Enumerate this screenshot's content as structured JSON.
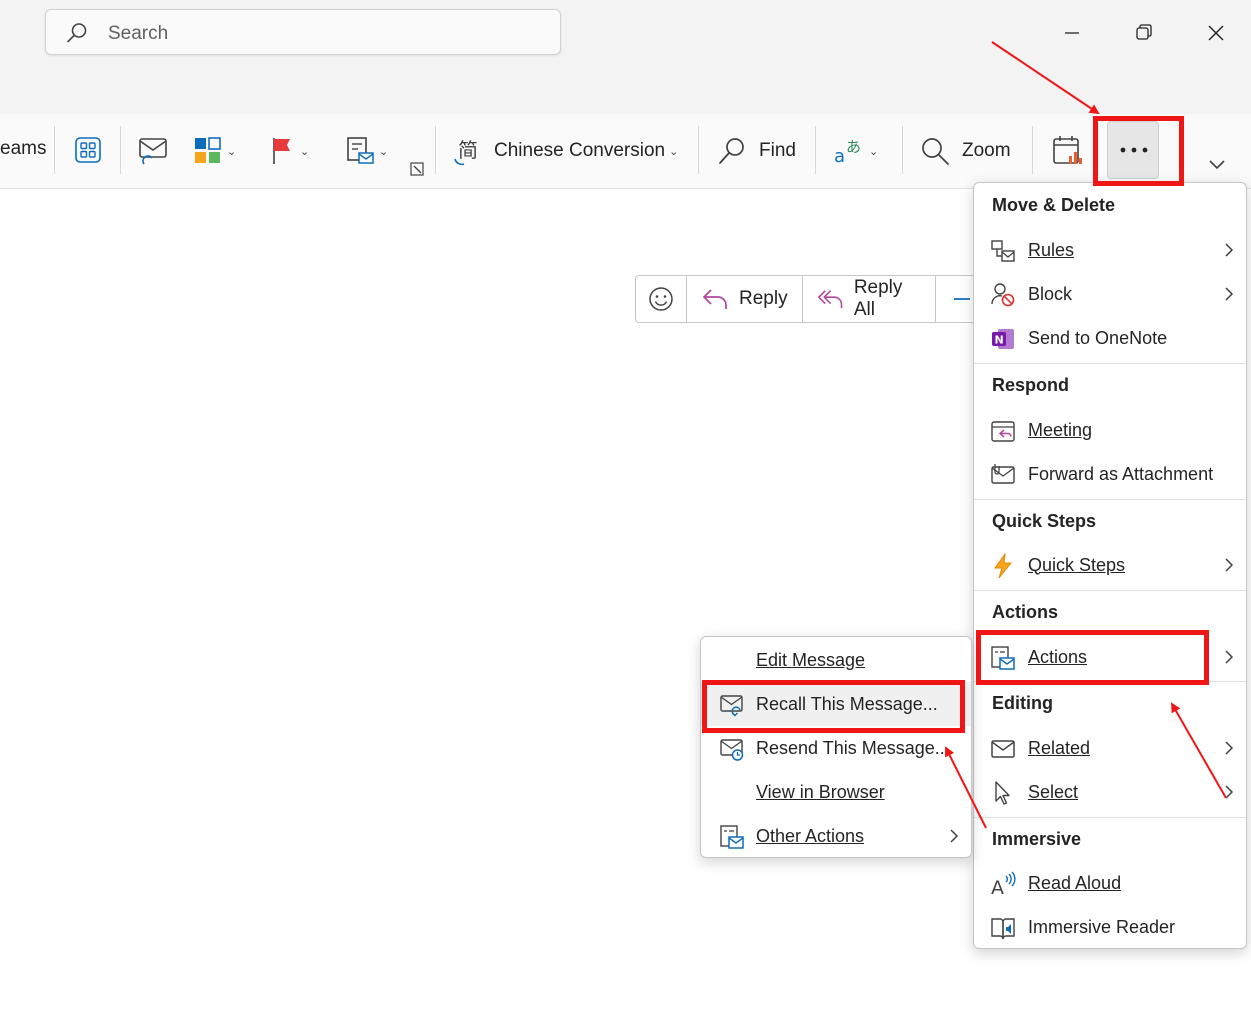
{
  "search": {
    "placeholder": "Search"
  },
  "ribbon": {
    "teams_partial": "eams",
    "chinese_conversion": "Chinese Conversion",
    "find": "Find",
    "zoom": "Zoom"
  },
  "reply_bar": {
    "reply": "Reply",
    "reply_all": "Reply All"
  },
  "menu": {
    "sections": {
      "move_delete": "Move & Delete",
      "respond": "Respond",
      "quick_steps": "Quick Steps",
      "actions": "Actions",
      "editing": "Editing",
      "immersive": "Immersive"
    },
    "items": {
      "rules": "Rules",
      "block": "Block",
      "send_to_onenote": "Send to OneNote",
      "meeting": "Meeting",
      "forward_as_attachment": "Forward as Attachment",
      "quick_steps": "Quick Steps",
      "actions": "Actions",
      "related": "Related",
      "select": "Select",
      "read_aloud": "Read Aloud",
      "immersive_reader": "Immersive Reader"
    }
  },
  "submenu": {
    "edit_message": "Edit Message",
    "recall_message": "Recall This Message...",
    "resend_message": "Resend This Message...",
    "view_in_browser": "View in Browser",
    "other_actions": "Other Actions"
  },
  "colors": {
    "highlight": "#f01616",
    "accent": "#0f6cbd",
    "onenote": "#7719aa"
  }
}
